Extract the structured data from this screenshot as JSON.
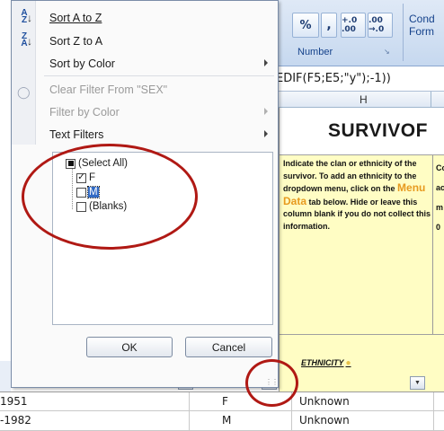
{
  "ribbon": {
    "percent": "%",
    "comma": ",",
    "increase_decimal": "+.0 .00",
    "decrease_decimal": ".00 →.0",
    "group_label": "Number",
    "conditional_formatting": "Cond\nForm"
  },
  "formula_bar": {
    "text": "EDIF(F5;E5;\"y\");-1))"
  },
  "column_header": {
    "label": "H"
  },
  "sheet": {
    "banner_title": "SURVIVOF",
    "instruction_1": "Indicate the clan or ethnicity of the survivor. To add an ethnicity to the dropdown menu, click on",
    "instruction_menu_prefix": "the ",
    "instruction_menu_data": "Menu Data",
    "instruction_menu_suffix": " tab",
    "instruction_2": "below. Hide or leave this column blank if you do not collect this information.",
    "instruction_next_col": "Co\nac\nm\n0",
    "ethnicity_header": "ETHNICITY",
    "rows": [
      {
        "dob": "1951",
        "sex": "F",
        "ethnicity": "Unknown"
      },
      {
        "dob": "-1982",
        "sex": "M",
        "ethnicity": "Unknown"
      }
    ]
  },
  "menu": {
    "sort_a_to_z": "Sort A to Z",
    "sort_z_to_a": "Sort Z to A",
    "sort_by_color": "Sort by Color",
    "clear_filter": "Clear Filter From \"SEX\"",
    "filter_by_color": "Filter by Color",
    "text_filters": "Text Filters",
    "checklist": [
      {
        "label": "(Select All)",
        "state": "partial"
      },
      {
        "label": "F",
        "state": "checked"
      },
      {
        "label": "M",
        "state": "unchecked"
      },
      {
        "label": "(Blanks)",
        "state": "unchecked"
      }
    ],
    "ok": "OK",
    "cancel": "Cancel"
  },
  "colors": {
    "annotation_red": "#b01914",
    "header_yellow": "#fffdc4",
    "menu_data_orange": "#e79a1f",
    "selection_blue": "#316ac5"
  }
}
